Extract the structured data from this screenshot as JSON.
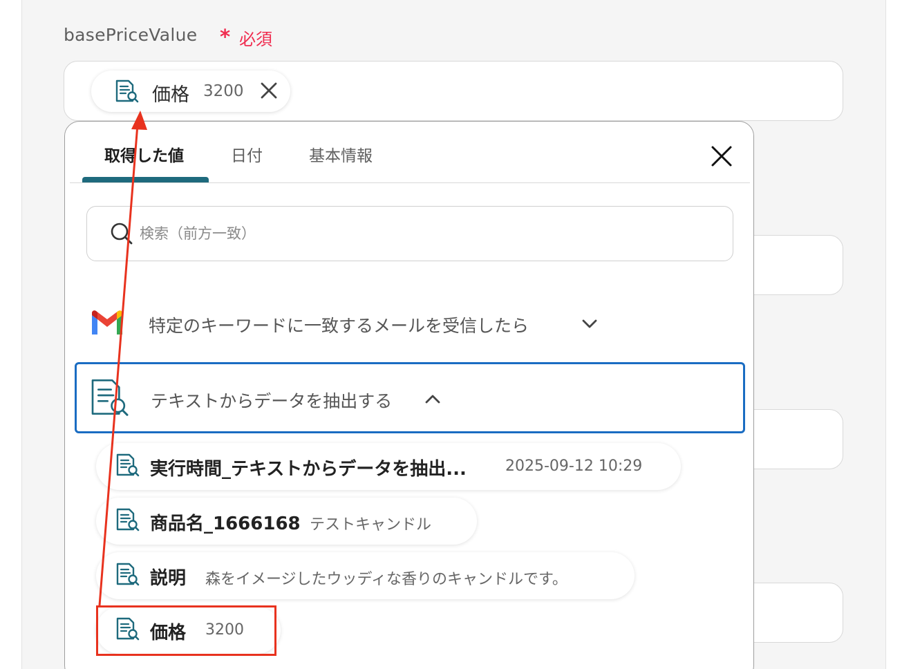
{
  "field": {
    "label": "basePriceValue",
    "required_mark": "*",
    "required_text": "必須"
  },
  "selected_chip": {
    "name": "価格",
    "value": "3200",
    "icon": "document-search-icon"
  },
  "popup": {
    "tabs": [
      {
        "label": "取得した値",
        "active": true
      },
      {
        "label": "日付",
        "active": false
      },
      {
        "label": "基本情報",
        "active": false
      }
    ],
    "search_placeholder": "検索（前方一致）",
    "sections": [
      {
        "title": "特定のキーワードに一致するメールを受信したら",
        "icon": "gmail-icon",
        "expanded": false
      },
      {
        "title": "テキストからデータを抽出する",
        "icon": "document-search-icon",
        "expanded": true
      }
    ],
    "items": [
      {
        "name": "実行時間_テキストからデータを抽出...",
        "value": "2025-09-12 10:29"
      },
      {
        "name": "商品名_1666168",
        "value": "テストキャンドル"
      },
      {
        "name": "説明",
        "value": "森をイメージしたウッディな香りのキャンドルです。"
      },
      {
        "name": "価格",
        "value": "3200"
      }
    ]
  },
  "colors": {
    "accent_teal": "#1e6a7d",
    "selection_blue": "#1a6cc2",
    "required_red": "#f02c4f",
    "annotation_red": "#e8321e"
  }
}
